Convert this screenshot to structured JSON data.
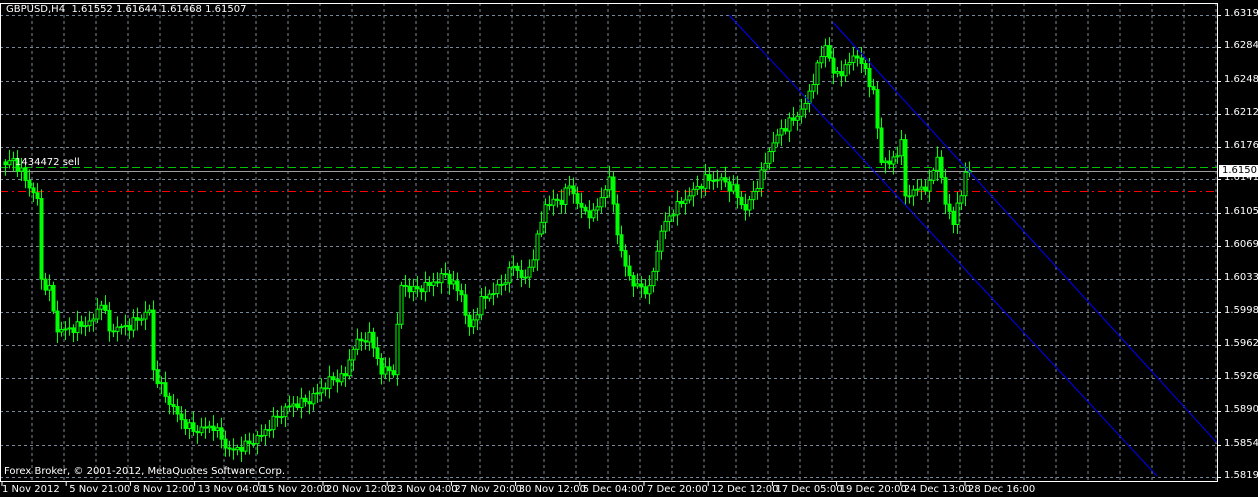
{
  "header": {
    "symbol_timeframe": "GBPUSD,H4",
    "open": "1.61552",
    "high": "1.61644",
    "low": "1.61468",
    "close": "1.61507"
  },
  "copyright": "Forex Broker, © 2001-2012, MetaQuotes Software Corp.",
  "order_label": "1434472 sell",
  "colors": {
    "background": "#000000",
    "candle": "#00ff00",
    "grid": "#778899",
    "channel": "#0000ff",
    "order_line": "#00c000",
    "stop_line": "#ff0000",
    "bid_line": "#a0a0a0"
  },
  "chart_data": {
    "type": "candlestick",
    "symbol": "GBPUSD",
    "timeframe": "H4",
    "ylim": [
      1.5819,
      1.6319
    ],
    "y_ticks": [
      "1.63190",
      "1.62840",
      "1.62480",
      "1.62120",
      "1.61760",
      "1.61410",
      "1.61050",
      "1.60690",
      "1.60330",
      "1.59980",
      "1.59620",
      "1.59260",
      "1.58900",
      "1.58540",
      "1.58190"
    ],
    "x_ticks": [
      "1 Nov 2012",
      "5 Nov 21:00",
      "8 Nov 12:00",
      "13 Nov 04:00",
      "15 Nov 20:00",
      "20 Nov 12:00",
      "23 Nov 04:00",
      "27 Nov 20:00",
      "30 Nov 12:00",
      "5 Dec 04:00",
      "7 Dec 20:00",
      "12 Dec 12:00",
      "17 Dec 05:00",
      "19 Dec 20:00",
      "24 Dec 13:00",
      "28 Dec 16:00"
    ],
    "bars_per_x_tick": 16,
    "bar_count": 242,
    "close_path": [
      [
        0,
        1.6157
      ],
      [
        2,
        1.61625
      ],
      [
        5,
        1.6141
      ],
      [
        8,
        1.6119
      ],
      [
        9,
        1.6032
      ],
      [
        11,
        1.6021
      ],
      [
        13,
        1.5978
      ],
      [
        15,
        1.5978
      ],
      [
        19,
        1.5983
      ],
      [
        22,
        1.5989
      ],
      [
        24,
        1.601
      ],
      [
        26,
        1.5978
      ],
      [
        31,
        1.5983
      ],
      [
        36,
        1.5999
      ],
      [
        37,
        1.5934
      ],
      [
        40,
        1.5907
      ],
      [
        44,
        1.588
      ],
      [
        47,
        1.5869
      ],
      [
        52,
        1.5874
      ],
      [
        56,
        1.5847
      ],
      [
        60,
        1.5853
      ],
      [
        64,
        1.5864
      ],
      [
        67,
        1.588
      ],
      [
        71,
        1.5896
      ],
      [
        76,
        1.5902
      ],
      [
        81,
        1.5923
      ],
      [
        85,
        1.5929
      ],
      [
        87,
        1.5961
      ],
      [
        91,
        1.5972
      ],
      [
        94,
        1.5934
      ],
      [
        97,
        1.5934
      ],
      [
        99,
        1.6027
      ],
      [
        102,
        1.6021
      ],
      [
        106,
        1.6027
      ],
      [
        110,
        1.6038
      ],
      [
        114,
        1.6016
      ],
      [
        116,
        1.5978
      ],
      [
        119,
        1.601
      ],
      [
        124,
        1.6027
      ],
      [
        127,
        1.6048
      ],
      [
        130,
        1.6032
      ],
      [
        132,
        1.6059
      ],
      [
        135,
        1.6114
      ],
      [
        139,
        1.6119
      ],
      [
        141,
        1.6135
      ],
      [
        144,
        1.6108
      ],
      [
        147,
        1.6103
      ],
      [
        151,
        1.6141
      ],
      [
        154,
        1.6059
      ],
      [
        157,
        1.6027
      ],
      [
        161,
        1.6021
      ],
      [
        164,
        1.6086
      ],
      [
        167,
        1.6108
      ],
      [
        171,
        1.6124
      ],
      [
        175,
        1.6141
      ],
      [
        179,
        1.6141
      ],
      [
        182,
        1.613
      ],
      [
        185,
        1.6108
      ],
      [
        189,
        1.6146
      ],
      [
        191,
        1.6173
      ],
      [
        194,
        1.6195
      ],
      [
        197,
        1.6206
      ],
      [
        200,
        1.6222
      ],
      [
        202,
        1.6249
      ],
      [
        205,
        1.6288
      ],
      [
        207,
        1.6255
      ],
      [
        210,
        1.626
      ],
      [
        212,
        1.6277
      ],
      [
        215,
        1.626
      ],
      [
        217,
        1.6233
      ],
      [
        219,
        1.6162
      ],
      [
        221,
        1.6157
      ],
      [
        224,
        1.6179
      ],
      [
        225,
        1.6124
      ],
      [
        228,
        1.613
      ],
      [
        231,
        1.6135
      ],
      [
        233,
        1.6168
      ],
      [
        235,
        1.6114
      ],
      [
        237,
        1.6097
      ],
      [
        239,
        1.6124
      ],
      [
        240,
        1.6152
      ],
      [
        241,
        1.61507
      ]
    ],
    "horizontal_lines": [
      {
        "name": "order-line",
        "price": 1.6155,
        "style": "dashed",
        "color": "#00c000"
      },
      {
        "name": "bid-line",
        "price": 1.61507,
        "style": "solid",
        "color": "#a0a0a0"
      },
      {
        "name": "stop-line",
        "price": 1.6128,
        "style": "dash-dot",
        "color": "#ff0000"
      }
    ],
    "channel_lines": [
      {
        "from": [
          181,
          1.6319
        ],
        "to": [
          288,
          1.582
        ]
      },
      {
        "from": [
          207,
          1.6311
        ],
        "to": [
          303,
          1.5856
        ]
      }
    ],
    "last_price_label": "1.61507"
  }
}
